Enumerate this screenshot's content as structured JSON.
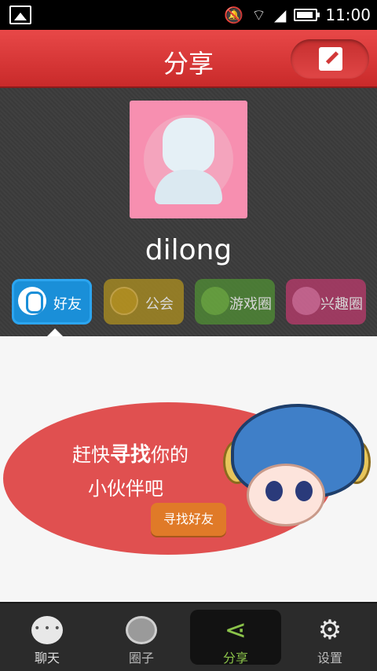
{
  "status_bar": {
    "time": "11:00"
  },
  "header": {
    "title": "分享"
  },
  "profile": {
    "username": "dilong"
  },
  "categories": [
    {
      "label": "好友"
    },
    {
      "label": "公会"
    },
    {
      "label": "游戏圈"
    },
    {
      "label": "兴趣圈"
    }
  ],
  "promo": {
    "line1_a": "赶快",
    "line1_highlight": "寻找",
    "line1_b": "你的",
    "line2": "小伙伴吧",
    "button": "寻找好友"
  },
  "tabs": [
    {
      "label": "聊天"
    },
    {
      "label": "圈子"
    },
    {
      "label": "分享"
    },
    {
      "label": "设置"
    }
  ]
}
